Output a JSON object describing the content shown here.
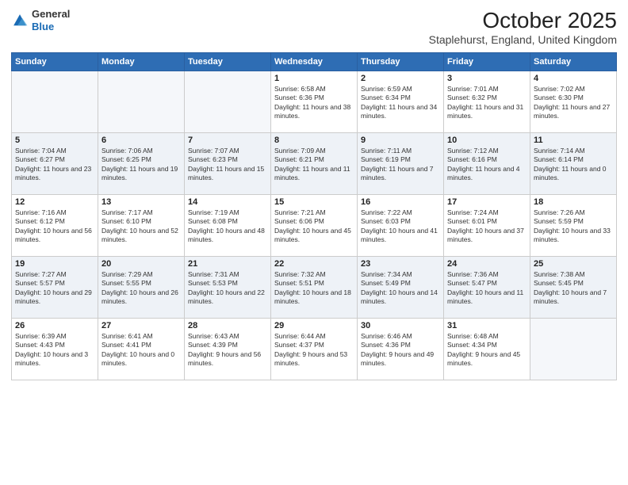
{
  "header": {
    "logo_general": "General",
    "logo_blue": "Blue",
    "month_title": "October 2025",
    "subtitle": "Staplehurst, England, United Kingdom"
  },
  "days_of_week": [
    "Sunday",
    "Monday",
    "Tuesday",
    "Wednesday",
    "Thursday",
    "Friday",
    "Saturday"
  ],
  "weeks": [
    [
      {
        "day": "",
        "sunrise": "",
        "sunset": "",
        "daylight": ""
      },
      {
        "day": "",
        "sunrise": "",
        "sunset": "",
        "daylight": ""
      },
      {
        "day": "",
        "sunrise": "",
        "sunset": "",
        "daylight": ""
      },
      {
        "day": "1",
        "sunrise": "6:58 AM",
        "sunset": "6:36 PM",
        "daylight": "11 hours and 38 minutes."
      },
      {
        "day": "2",
        "sunrise": "6:59 AM",
        "sunset": "6:34 PM",
        "daylight": "11 hours and 34 minutes."
      },
      {
        "day": "3",
        "sunrise": "7:01 AM",
        "sunset": "6:32 PM",
        "daylight": "11 hours and 31 minutes."
      },
      {
        "day": "4",
        "sunrise": "7:02 AM",
        "sunset": "6:30 PM",
        "daylight": "11 hours and 27 minutes."
      }
    ],
    [
      {
        "day": "5",
        "sunrise": "7:04 AM",
        "sunset": "6:27 PM",
        "daylight": "11 hours and 23 minutes."
      },
      {
        "day": "6",
        "sunrise": "7:06 AM",
        "sunset": "6:25 PM",
        "daylight": "11 hours and 19 minutes."
      },
      {
        "day": "7",
        "sunrise": "7:07 AM",
        "sunset": "6:23 PM",
        "daylight": "11 hours and 15 minutes."
      },
      {
        "day": "8",
        "sunrise": "7:09 AM",
        "sunset": "6:21 PM",
        "daylight": "11 hours and 11 minutes."
      },
      {
        "day": "9",
        "sunrise": "7:11 AM",
        "sunset": "6:19 PM",
        "daylight": "11 hours and 7 minutes."
      },
      {
        "day": "10",
        "sunrise": "7:12 AM",
        "sunset": "6:16 PM",
        "daylight": "11 hours and 4 minutes."
      },
      {
        "day": "11",
        "sunrise": "7:14 AM",
        "sunset": "6:14 PM",
        "daylight": "11 hours and 0 minutes."
      }
    ],
    [
      {
        "day": "12",
        "sunrise": "7:16 AM",
        "sunset": "6:12 PM",
        "daylight": "10 hours and 56 minutes."
      },
      {
        "day": "13",
        "sunrise": "7:17 AM",
        "sunset": "6:10 PM",
        "daylight": "10 hours and 52 minutes."
      },
      {
        "day": "14",
        "sunrise": "7:19 AM",
        "sunset": "6:08 PM",
        "daylight": "10 hours and 48 minutes."
      },
      {
        "day": "15",
        "sunrise": "7:21 AM",
        "sunset": "6:06 PM",
        "daylight": "10 hours and 45 minutes."
      },
      {
        "day": "16",
        "sunrise": "7:22 AM",
        "sunset": "6:03 PM",
        "daylight": "10 hours and 41 minutes."
      },
      {
        "day": "17",
        "sunrise": "7:24 AM",
        "sunset": "6:01 PM",
        "daylight": "10 hours and 37 minutes."
      },
      {
        "day": "18",
        "sunrise": "7:26 AM",
        "sunset": "5:59 PM",
        "daylight": "10 hours and 33 minutes."
      }
    ],
    [
      {
        "day": "19",
        "sunrise": "7:27 AM",
        "sunset": "5:57 PM",
        "daylight": "10 hours and 29 minutes."
      },
      {
        "day": "20",
        "sunrise": "7:29 AM",
        "sunset": "5:55 PM",
        "daylight": "10 hours and 26 minutes."
      },
      {
        "day": "21",
        "sunrise": "7:31 AM",
        "sunset": "5:53 PM",
        "daylight": "10 hours and 22 minutes."
      },
      {
        "day": "22",
        "sunrise": "7:32 AM",
        "sunset": "5:51 PM",
        "daylight": "10 hours and 18 minutes."
      },
      {
        "day": "23",
        "sunrise": "7:34 AM",
        "sunset": "5:49 PM",
        "daylight": "10 hours and 14 minutes."
      },
      {
        "day": "24",
        "sunrise": "7:36 AM",
        "sunset": "5:47 PM",
        "daylight": "10 hours and 11 minutes."
      },
      {
        "day": "25",
        "sunrise": "7:38 AM",
        "sunset": "5:45 PM",
        "daylight": "10 hours and 7 minutes."
      }
    ],
    [
      {
        "day": "26",
        "sunrise": "6:39 AM",
        "sunset": "4:43 PM",
        "daylight": "10 hours and 3 minutes."
      },
      {
        "day": "27",
        "sunrise": "6:41 AM",
        "sunset": "4:41 PM",
        "daylight": "10 hours and 0 minutes."
      },
      {
        "day": "28",
        "sunrise": "6:43 AM",
        "sunset": "4:39 PM",
        "daylight": "9 hours and 56 minutes."
      },
      {
        "day": "29",
        "sunrise": "6:44 AM",
        "sunset": "4:37 PM",
        "daylight": "9 hours and 53 minutes."
      },
      {
        "day": "30",
        "sunrise": "6:46 AM",
        "sunset": "4:36 PM",
        "daylight": "9 hours and 49 minutes."
      },
      {
        "day": "31",
        "sunrise": "6:48 AM",
        "sunset": "4:34 PM",
        "daylight": "9 hours and 45 minutes."
      },
      {
        "day": "",
        "sunrise": "",
        "sunset": "",
        "daylight": ""
      }
    ]
  ]
}
